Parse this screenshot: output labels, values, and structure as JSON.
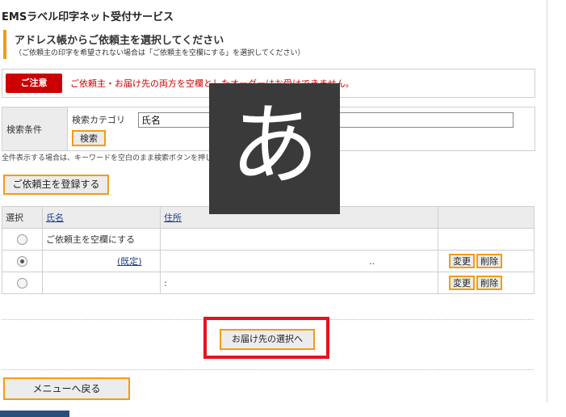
{
  "app": {
    "title": "EMSラベル印字ネット受付サービス"
  },
  "heading": {
    "main": "アドレス帳からご依頼主を選択してください",
    "sub": "（ご依頼主の印字を希望されない場合は「ご依頼主を空欄にする」を選択してください）"
  },
  "notice": {
    "badge": "ご注意",
    "text": "ご依頼主・お届け先の両方を空欄としたオーダーはお受けできません。"
  },
  "search": {
    "label": "検索条件",
    "category_label": "検索カテゴリ",
    "category_value": "氏名",
    "keyword_value": "",
    "button": "検索",
    "hint": "全件表示する場合は、キーワードを空白のまま検索ボタンを押してください。"
  },
  "register_button": "ご依頼主を登録する",
  "table": {
    "headers": {
      "select": "選択",
      "name": "氏名",
      "address": "住所"
    },
    "rows": [
      {
        "name": "ご依頼主を空欄にする",
        "address": "",
        "checked": false
      },
      {
        "name": "",
        "default_label": "(既定)",
        "address": "..",
        "checked": true
      },
      {
        "name": "",
        "address": ":",
        "checked": false
      }
    ],
    "edit_button": "変更",
    "delete_button": "削除"
  },
  "next_button": "お届け先の選択へ",
  "menu_button": "メニューへ戻る",
  "ime_overlay": {
    "char": "あ"
  },
  "colors": {
    "accent": "#f39c12",
    "alert": "#cc0000",
    "highlight": "#e5131d",
    "link": "#1a3e8a"
  }
}
